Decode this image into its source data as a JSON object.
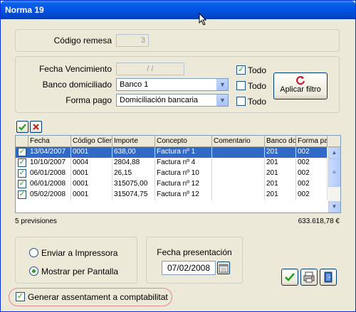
{
  "window": {
    "title": "Norma 19"
  },
  "remesa": {
    "label": "Código remesa",
    "value": "3"
  },
  "filters": {
    "fecha_vencimiento_label": "Fecha Vencimiento",
    "fecha_vencimiento_value": "/ /",
    "banco_label": "Banco domiciliado",
    "banco_value": "Banco 1",
    "forma_pago_label": "Forma pago",
    "forma_pago_value": "Domiciliación bancaria",
    "todo_label": "Todo",
    "todo_1_checked": true,
    "todo_2_checked": false,
    "todo_3_checked": false,
    "apply_button_label": "Aplicar filtro"
  },
  "grid": {
    "columns": [
      "Fecha",
      "Código Client",
      "Importe",
      "Concepto",
      "Comentario",
      "Banco do",
      "Forma pa"
    ],
    "rows": [
      [
        "13/04/2007",
        "0001",
        "638,00",
        "Factura nº 1",
        "",
        "201",
        "002"
      ],
      [
        "10/10/2007",
        "0004",
        "2804,88",
        "Factura nº 4",
        "",
        "201",
        "002"
      ],
      [
        "06/01/2008",
        "0001",
        "26,15",
        "Factura nº 10",
        "",
        "201",
        "002"
      ],
      [
        "06/01/2008",
        "0001",
        "315075,00",
        "Factura nº 12",
        "",
        "201",
        "002"
      ],
      [
        "05/02/2008",
        "0001",
        "315074,75",
        "Factura nº 12",
        "",
        "201",
        "002"
      ]
    ],
    "count_label": "5 previsiones",
    "total": "633.618,78 €"
  },
  "output": {
    "option_printer": "Enviar a Impressora",
    "option_screen": "Mostrar per Pantalla",
    "selected": "screen"
  },
  "presentacion": {
    "label": "Fecha presentación",
    "value": "07/02/2008"
  },
  "generar": {
    "label": "Generar assentament a comptabilitat",
    "checked": true
  },
  "colors": {
    "title_bar": "#0054e3",
    "selection": "#3169c6",
    "check": "#21a121",
    "highlight_ring": "#e38a8a"
  }
}
